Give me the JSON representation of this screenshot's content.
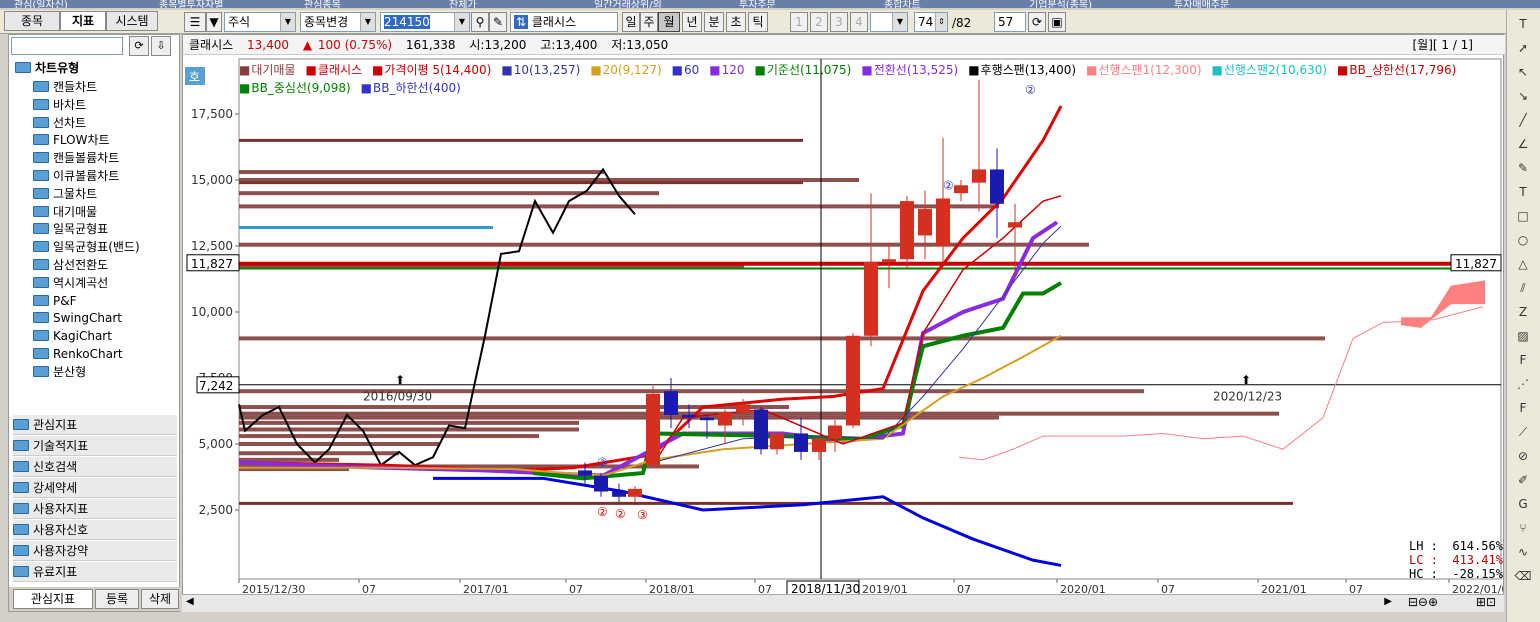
{
  "top_tabs": [
    "관심(일자신)",
    "종목별투자자별",
    "관심종목",
    "잔체가",
    "일간거래상위/외",
    "투자주문",
    "종합차트",
    "기업분석(종목)",
    "투자매매주문"
  ],
  "sidebar": {
    "tabs": [
      "종목",
      "지표",
      "시스템"
    ],
    "active_tab": "지표",
    "tree_title": "차트유형",
    "tree_items": [
      "캔들차트",
      "바차트",
      "선차트",
      "FLOW차트",
      "캔들볼륨차트",
      "이큐볼륨차트",
      "그물차트",
      "대기매물",
      "일목균형표",
      "일목균형표(밴드)",
      "삼선전환도",
      "역시계곡선",
      "P&F",
      "SwingChart",
      "KagiChart",
      "RenkoChart",
      "분산형"
    ],
    "categories": [
      "관심지표",
      "기술적지표",
      "신호검색",
      "강세약세",
      "사용자지표",
      "사용자신호",
      "사용자강약",
      "유료지표"
    ],
    "bottom_buttons": [
      "관심지표",
      "등록",
      "삭제"
    ]
  },
  "toolbar": {
    "market": "주식",
    "change_label": "종목변경",
    "code": "214150",
    "name": "클래시스",
    "period_buttons": [
      "일",
      "주",
      "월",
      "년",
      "분",
      "초",
      "틱"
    ],
    "selected_period": "월",
    "numbers": [
      "1",
      "2",
      "3",
      "4"
    ],
    "count": "74",
    "total": "/82",
    "zoom": "57"
  },
  "info_bar": {
    "name": "클래시스",
    "price": "13,400",
    "change_symbol": "▲",
    "change": "100 (0.75%)",
    "volume": "161,338",
    "open": "시:13,200",
    "high": "고:13,400",
    "low": "저:13,050",
    "page": "[월][ 1 / 1]"
  },
  "legend": {
    "row1": [
      {
        "text": "대기매물",
        "color": "#8b3a3a"
      },
      {
        "text": "클래시스",
        "color": "#cc0000"
      },
      {
        "text": "가격이평 5(14,400)",
        "color": "#cc0000"
      },
      {
        "text": "10(13,257)",
        "color": "#3333aa"
      },
      {
        "text": "20(9,127)",
        "color": "#d4a020"
      },
      {
        "text": "60",
        "color": "#3333cc"
      },
      {
        "text": "120",
        "color": "#8a2be2"
      },
      {
        "text": "기준선(11,075)",
        "color": "#008000"
      },
      {
        "text": "전환선(13,525)",
        "color": "#8a2be2"
      },
      {
        "text": "후행스팬(13,400)",
        "color": "#000000"
      },
      {
        "text": "선행스팬1(12,300)",
        "color": "#ff8080"
      },
      {
        "text": "선행스팬2(10,630)",
        "color": "#20c0c0"
      },
      {
        "text": "BB_상한선(17,796)",
        "color": "#cc0000"
      }
    ],
    "row2": [
      {
        "text": "BB_중심선(9,098)",
        "color": "#008000"
      },
      {
        "text": "BB_하한선(400)",
        "color": "#3333cc"
      }
    ]
  },
  "chart_data": {
    "type": "candlestick",
    "title": "클래시스 월봉",
    "y_ticks": [
      "17,500",
      "15,000",
      "12,500",
      "10,000",
      "7,500",
      "5,000",
      "2,500"
    ],
    "x_ticks": [
      "2015/12/30",
      "07",
      "2017/01",
      "07",
      "2018/01",
      "07",
      "2019/01",
      "07",
      "2020/01",
      "07",
      "2021/01",
      "07",
      "2022/01/05"
    ],
    "crosshair_x_label": "2018/11/30",
    "price_marker": "11,827",
    "price_marker2": "7,242",
    "annotations": [
      "2016/09/30",
      "2020/12/23"
    ],
    "candles": [
      [
        4000,
        4300,
        3500,
        3800
      ],
      [
        3800,
        3900,
        3000,
        3200
      ],
      [
        3200,
        3500,
        2800,
        3000
      ],
      [
        3000,
        3400,
        2800,
        3300
      ],
      [
        4200,
        7200,
        4100,
        6900
      ],
      [
        7000,
        7500,
        5600,
        6100
      ],
      [
        6100,
        6500,
        5600,
        6000
      ],
      [
        6000,
        6100,
        5200,
        5900
      ],
      [
        5700,
        6300,
        5000,
        6200
      ],
      [
        6200,
        6700,
        5700,
        6500
      ],
      [
        6300,
        6400,
        4600,
        4800
      ],
      [
        4800,
        5300,
        4600,
        5400
      ],
      [
        5400,
        6000,
        4400,
        4700
      ],
      [
        4700,
        5300,
        4400,
        5200
      ],
      [
        5200,
        5900,
        4700,
        5700
      ],
      [
        5700,
        9200,
        5600,
        9100
      ],
      [
        9100,
        14500,
        8700,
        11900
      ],
      [
        11900,
        12600,
        10900,
        12000
      ],
      [
        12000,
        14400,
        11600,
        14200
      ],
      [
        12900,
        14600,
        12000,
        13900
      ],
      [
        12500,
        16600,
        11900,
        14300
      ],
      [
        14500,
        15000,
        14200,
        14800
      ],
      [
        14900,
        18800,
        13800,
        15400
      ],
      [
        15400,
        16200,
        12800,
        14100
      ],
      [
        13200,
        14100,
        11300,
        13400
      ]
    ],
    "stats": {
      "LH": "614.56%",
      "LC": "413.41%",
      "HC": "-28.15%"
    }
  },
  "colors": {
    "up": "#d33020",
    "down": "#1a1ab0",
    "accent": "#316ac5"
  }
}
